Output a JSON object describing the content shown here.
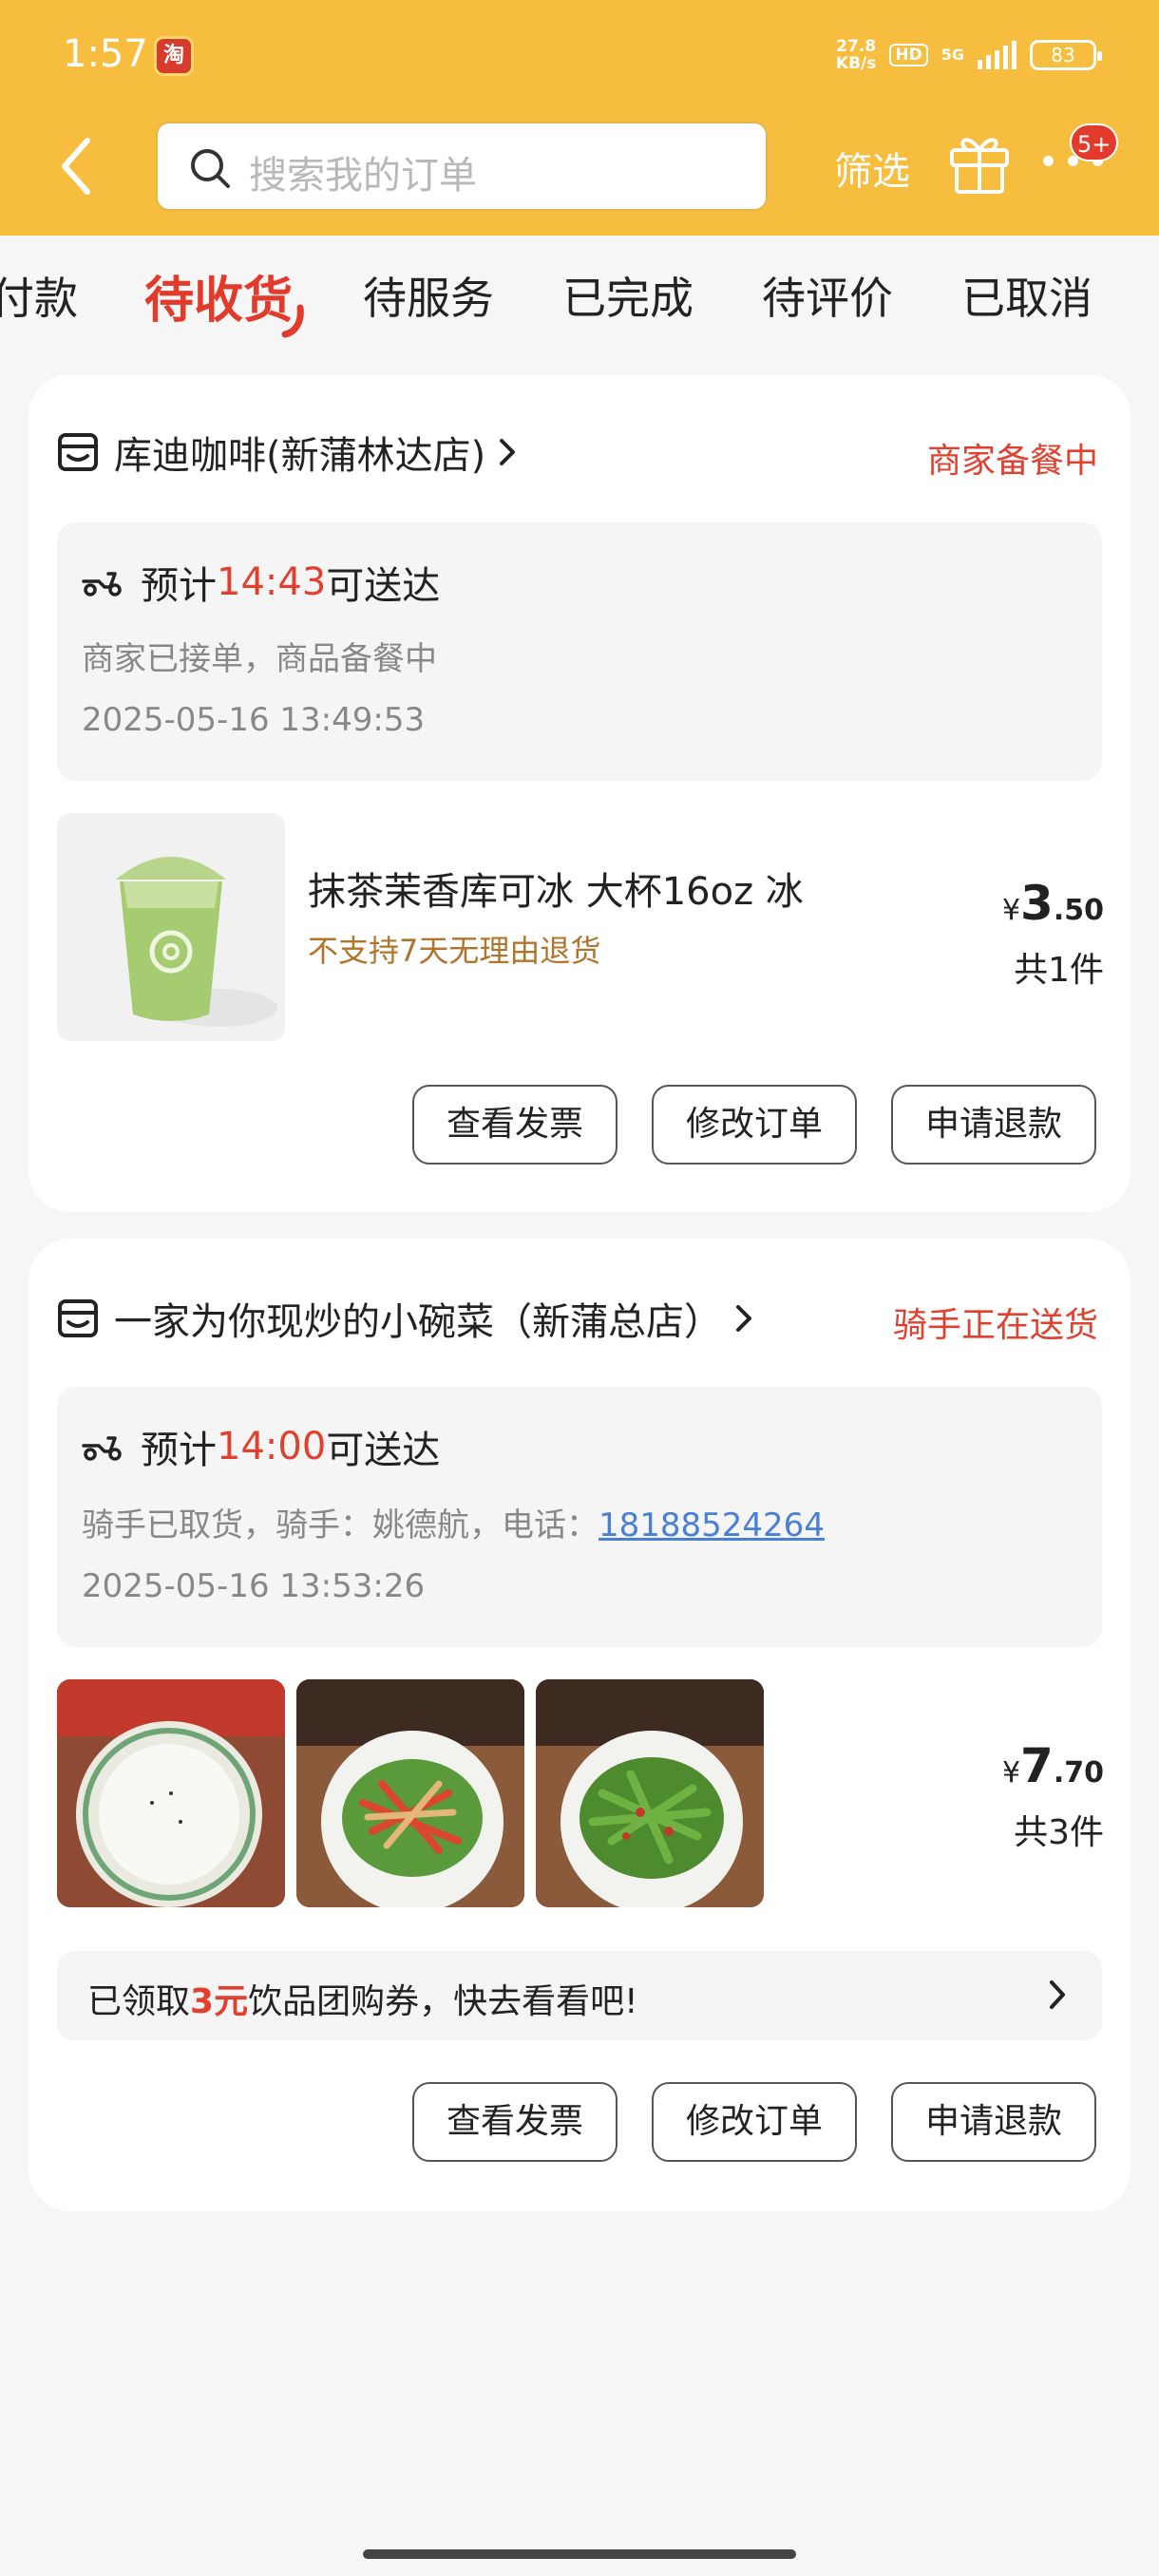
{
  "status_bar": {
    "time": "1:57",
    "speed_top": "27.8",
    "speed_unit": "KB/s",
    "hd": "HD",
    "network": "5G",
    "battery": "83"
  },
  "header": {
    "search_placeholder": "搜索我的订单",
    "filter_label": "筛选",
    "notification_badge": "5+"
  },
  "tabs": [
    {
      "label": "付款",
      "active": false
    },
    {
      "label": "待收货",
      "active": true
    },
    {
      "label": "待服务",
      "active": false
    },
    {
      "label": "已完成",
      "active": false
    },
    {
      "label": "待评价",
      "active": false
    },
    {
      "label": "已取消",
      "active": false
    }
  ],
  "orders": [
    {
      "shop_name": "库迪咖啡(新蒲林达店)",
      "status": "商家备餐中",
      "eta_prefix": "预计",
      "eta_time": "14:43",
      "eta_suffix": "可送达",
      "sub_line1": "商家已接单，商品备餐中",
      "sub_line2": "2025-05-16 13:49:53",
      "product_name": "抹茶茉香库可冰 大杯16oz 冰",
      "product_note": "不支持7天无理由退货",
      "price_symbol": "¥",
      "price_int": "3",
      "price_dec": ".50",
      "quantity": "共1件",
      "buttons": [
        "查看发票",
        "修改订单",
        "申请退款"
      ]
    },
    {
      "shop_name": "一家为你现炒的小碗菜（新蒲总店）",
      "status": "骑手正在送货",
      "eta_prefix": "预计",
      "eta_time": "14:00",
      "eta_suffix": "可送达",
      "sub_line1_prefix": "骑手已取货，骑手：姚德航，电话：",
      "rider_phone": "18188524264",
      "sub_line2": "2025-05-16 13:53:26",
      "price_symbol": "¥",
      "price_int": "7",
      "price_dec": ".70",
      "quantity": "共3件",
      "coupon_prefix": "已领取",
      "coupon_amount": "3元",
      "coupon_suffix": "饮品团购券，快去看看吧!",
      "buttons": [
        "查看发票",
        "修改订单",
        "申请退款"
      ]
    }
  ],
  "colors": {
    "header_bg": "#f6bd3f",
    "accent_red": "#e2402f",
    "link_blue": "#4a7fd6",
    "note_brown": "#b1742a"
  }
}
